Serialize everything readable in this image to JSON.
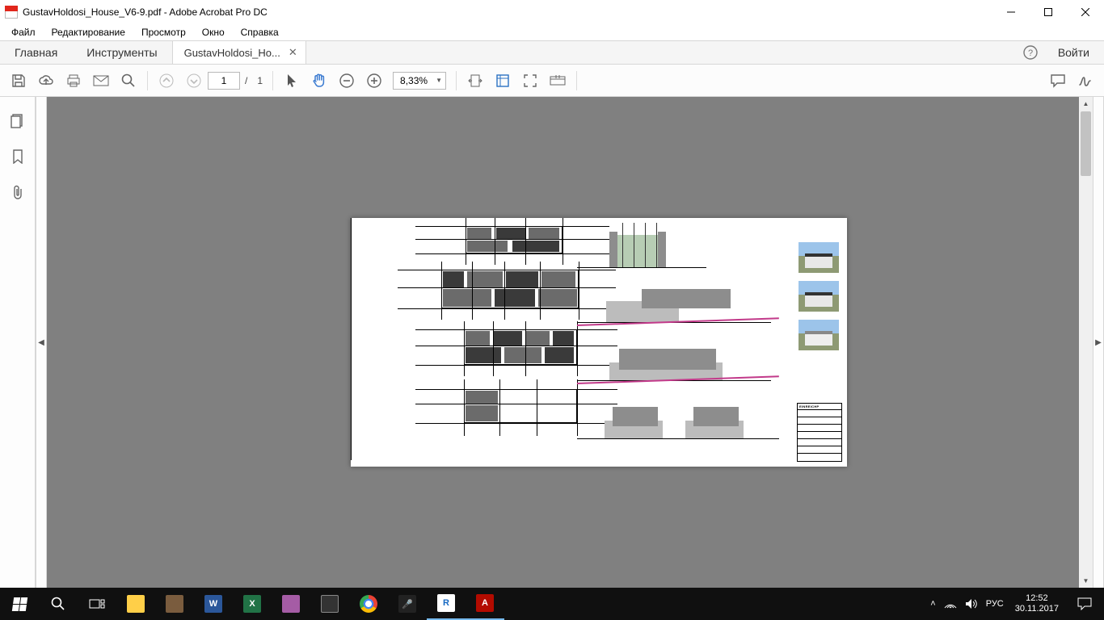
{
  "window": {
    "title": "GustavHoldosi_House_V6-9.pdf - Adobe Acrobat Pro DC"
  },
  "menu": {
    "file": "Файл",
    "edit": "Редактирование",
    "view": "Просмотр",
    "window": "Окно",
    "help": "Справка"
  },
  "tabs": {
    "home": "Главная",
    "tools": "Инструменты",
    "doc": "GustavHoldosi_Ho...",
    "login": "Войти"
  },
  "toolbar": {
    "page_current": "1",
    "page_sep": "/",
    "page_total": "1",
    "zoom": "8,33%"
  },
  "document": {
    "titleblock_header": "EINREICHP"
  },
  "tray": {
    "lang": "РУС",
    "time": "12:52",
    "date": "30.11.2017"
  }
}
